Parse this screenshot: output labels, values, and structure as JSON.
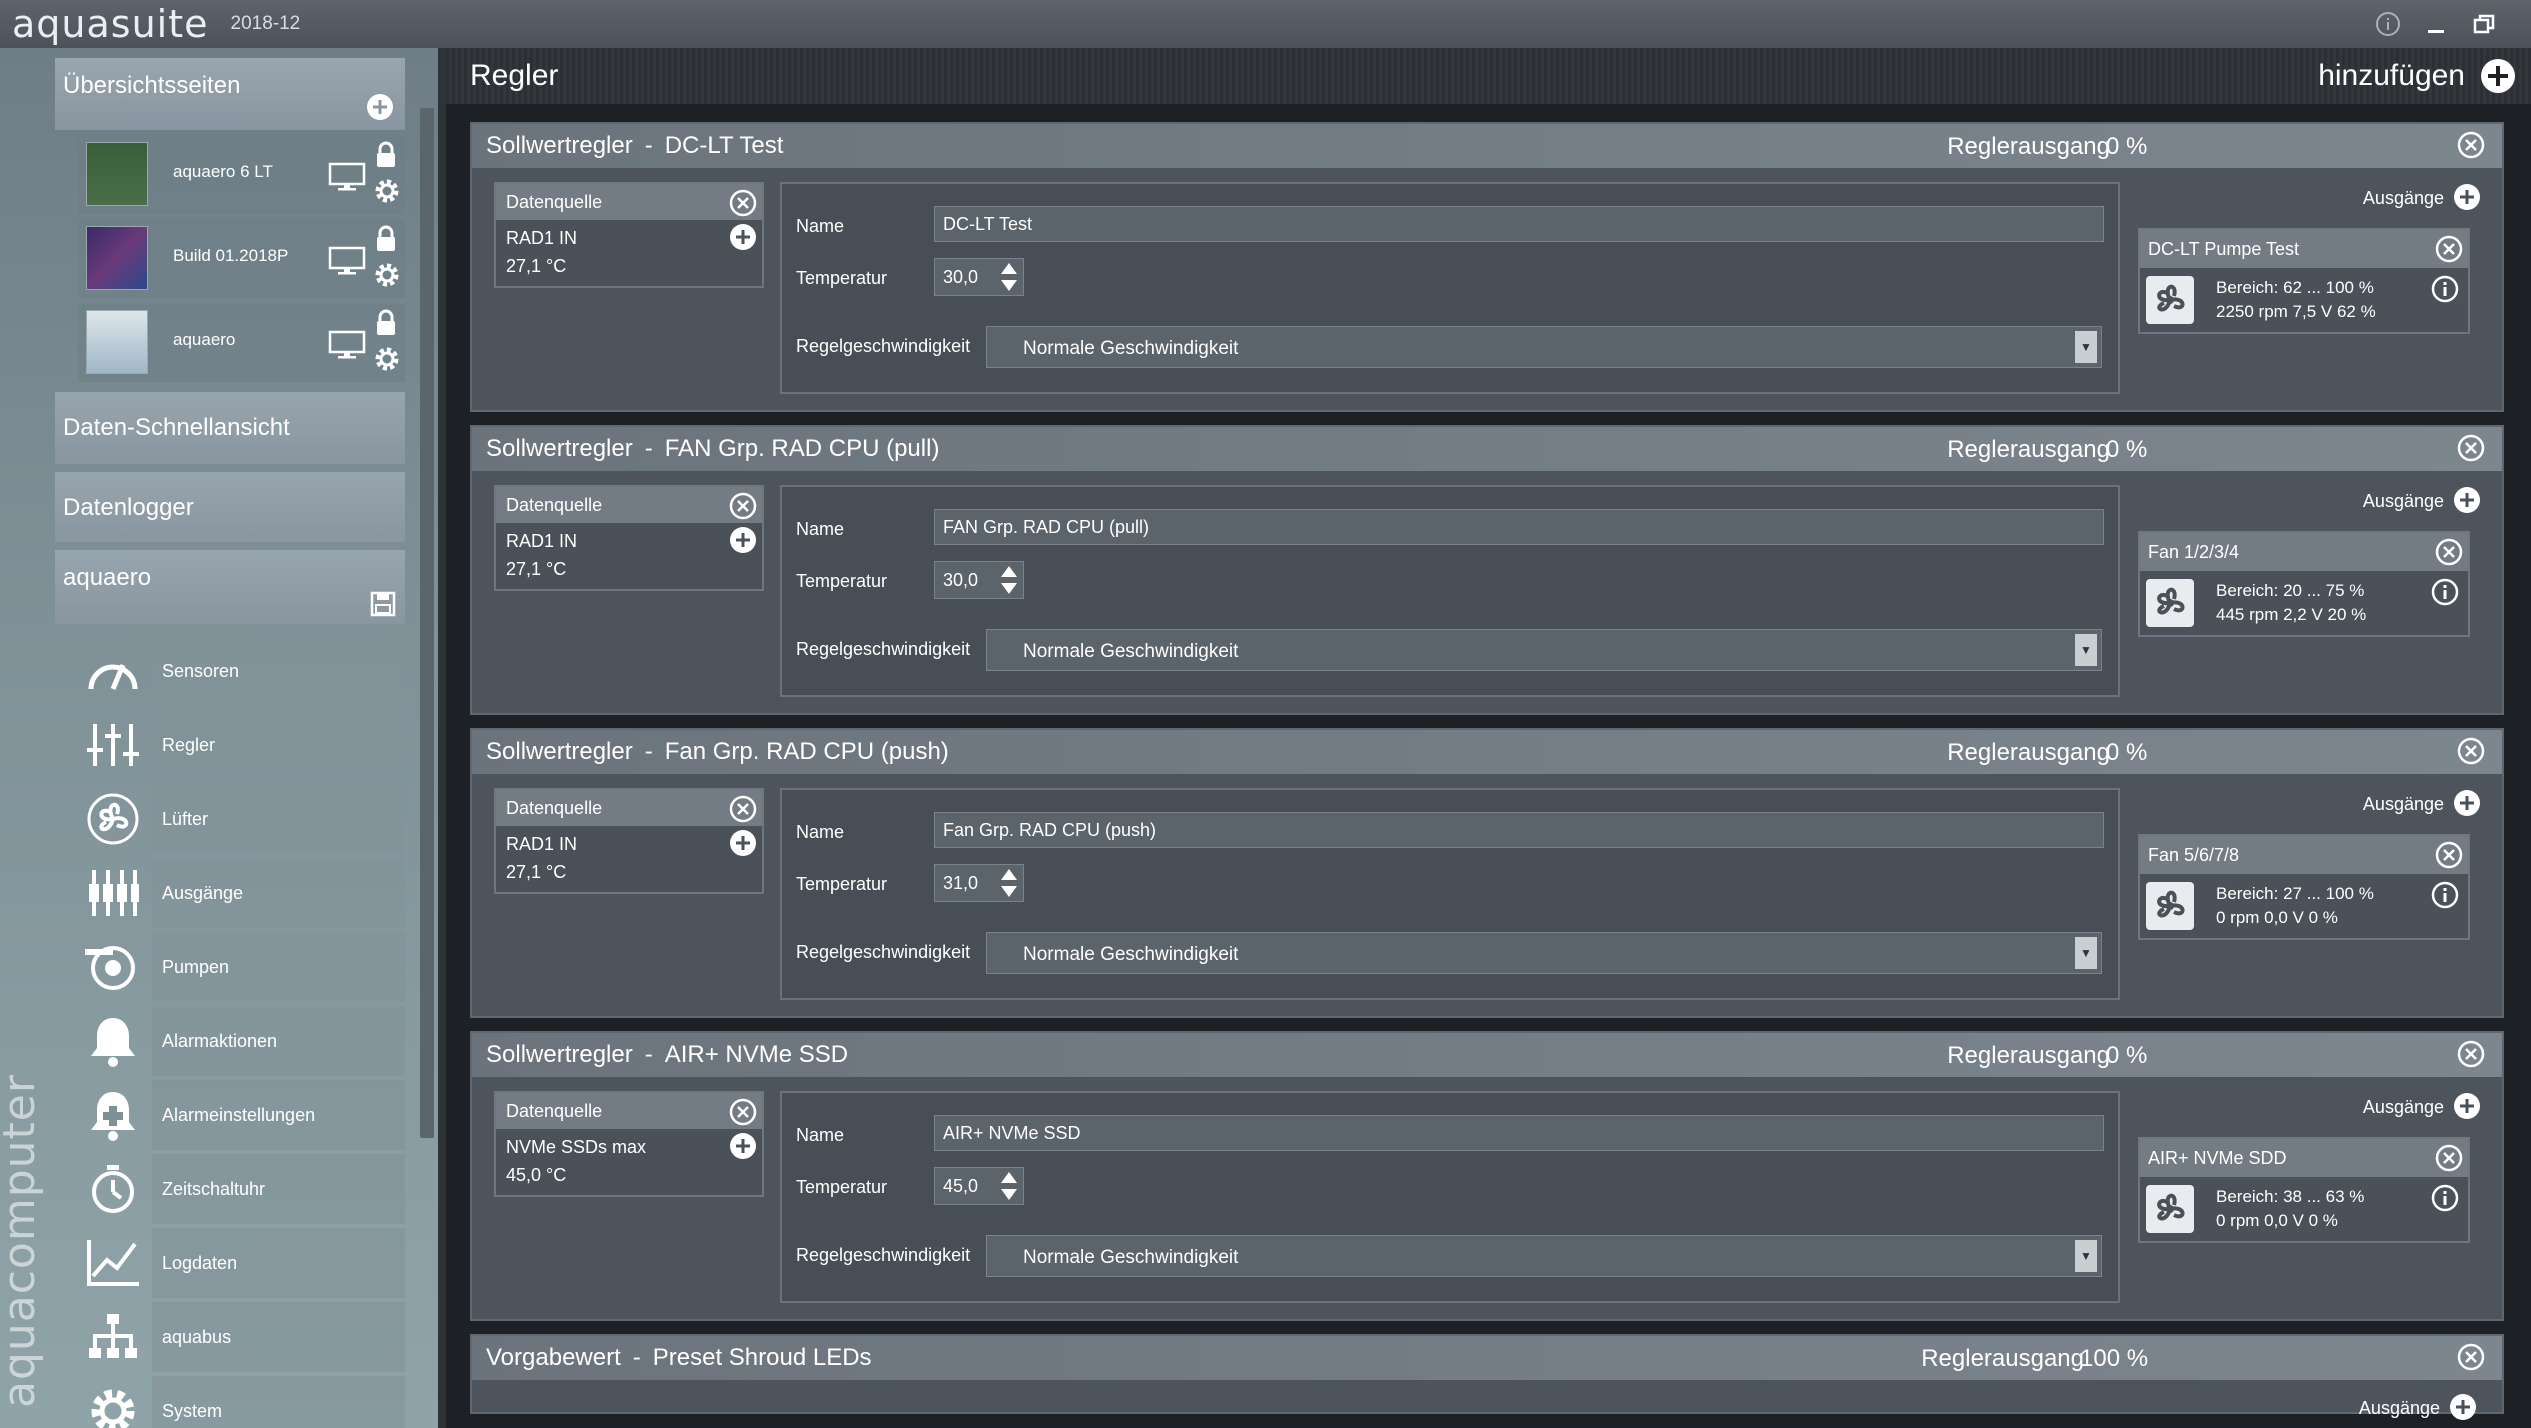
{
  "app": {
    "title": "aquasuite",
    "version": "2018-12",
    "brand_vertical": "aquacomputer"
  },
  "sidebar": {
    "overview_title": "Übersichtsseiten",
    "pages": [
      {
        "label": "aquaero 6 LT"
      },
      {
        "label": "Build 01.2018P"
      },
      {
        "label": "aquaero"
      }
    ],
    "quick_view": "Daten-Schnellansicht",
    "datalogger": "Datenlogger",
    "device": "aquaero",
    "nav": [
      {
        "label": "Sensoren",
        "icon": "gauge-icon"
      },
      {
        "label": "Regler",
        "icon": "sliders-icon"
      },
      {
        "label": "Lüfter",
        "icon": "fan-icon"
      },
      {
        "label": "Ausgänge",
        "icon": "outputs-icon"
      },
      {
        "label": "Pumpen",
        "icon": "pump-icon"
      },
      {
        "label": "Alarmaktionen",
        "icon": "bell-icon"
      },
      {
        "label": "Alarmeinstellungen",
        "icon": "bell-settings-icon"
      },
      {
        "label": "Zeitschaltuhr",
        "icon": "timer-icon"
      },
      {
        "label": "Logdaten",
        "icon": "chart-icon"
      },
      {
        "label": "aquabus",
        "icon": "network-icon"
      },
      {
        "label": "System",
        "icon": "gear-icon"
      }
    ]
  },
  "main": {
    "title": "Regler",
    "add_label": "hinzufügen",
    "labels": {
      "datasource": "Datenquelle",
      "name": "Name",
      "temperature": "Temperatur",
      "speed": "Regelgeschwindigkeit",
      "outputs": "Ausgänge",
      "regler_output": "Reglerausgang"
    },
    "controllers": [
      {
        "type": "Sollwertregler",
        "name": "DC-LT Test",
        "output": "0 %",
        "source": "RAD1 IN",
        "source_value": "27,1 °C",
        "name_value": "DC-LT Test",
        "temp": "30,0",
        "speed": "Normale Geschwindigkeit",
        "out_name": "DC-LT Pumpe Test",
        "out_range": "Bereich:  62 ... 100  %",
        "out_stats": "2250 rpm  7,5 V  62 %"
      },
      {
        "type": "Sollwertregler",
        "name": "FAN Grp. RAD CPU (pull)",
        "output": "0 %",
        "source": "RAD1 IN",
        "source_value": "27,1 °C",
        "name_value": "FAN Grp. RAD CPU (pull)",
        "temp": "30,0",
        "speed": "Normale Geschwindigkeit",
        "out_name": "Fan 1/2/3/4",
        "out_range": "Bereich:  20 ... 75  %",
        "out_stats": "445 rpm  2,2 V  20 %"
      },
      {
        "type": "Sollwertregler",
        "name": "Fan Grp. RAD CPU (push)",
        "output": "0 %",
        "source": "RAD1 IN",
        "source_value": "27,1 °C",
        "name_value": "Fan Grp. RAD CPU (push)",
        "temp": "31,0",
        "speed": "Normale Geschwindigkeit",
        "out_name": "Fan 5/6/7/8",
        "out_range": "Bereich:  27 ... 100  %",
        "out_stats": "0 rpm  0,0 V  0 %"
      },
      {
        "type": "Sollwertregler",
        "name": "AIR+ NVMe SSD",
        "output": "0 %",
        "source": "NVMe SSDs max",
        "source_value": "45,0 °C",
        "name_value": "AIR+ NVMe SSD",
        "temp": "45,0",
        "speed": "Normale Geschwindigkeit",
        "out_name": "AIR+ NVMe SDD",
        "out_range": "Bereich:  38 ... 63  %",
        "out_stats": "0 rpm  0,0 V  0 %"
      }
    ],
    "preset": {
      "type": "Vorgabewert",
      "name": "Preset Shroud LEDs",
      "output": "100 %",
      "outputs_label": "Ausgänge"
    }
  }
}
